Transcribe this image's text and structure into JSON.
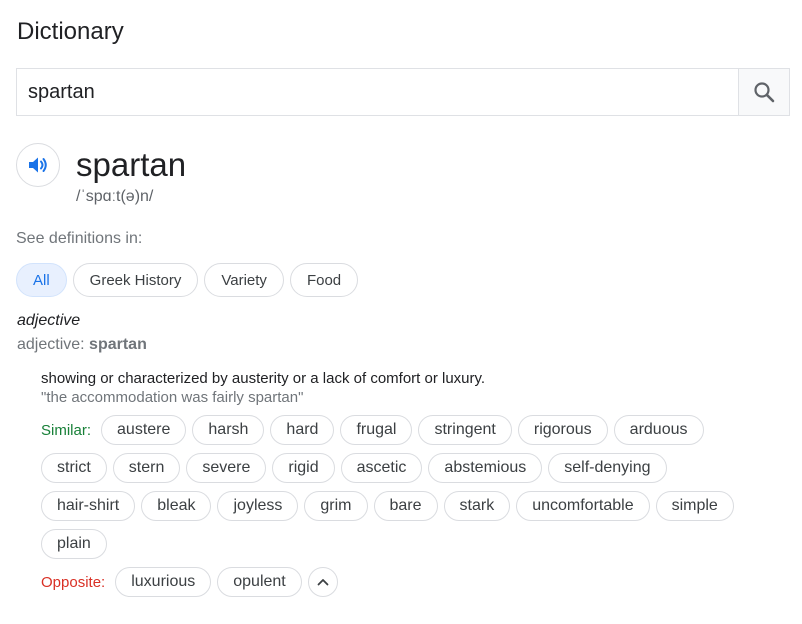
{
  "title": "Dictionary",
  "search": {
    "value": "spartan"
  },
  "entry": {
    "word": "spartan",
    "phonetic": "/ˈspɑːt(ə)n/"
  },
  "see_definitions_label": "See definitions in:",
  "categories": [
    "All",
    "Greek History",
    "Variety",
    "Food"
  ],
  "sense": {
    "part_of_speech": "adjective",
    "pos_prefix": "adjective: ",
    "pos_word": "spartan",
    "definition": "showing or characterized by austerity or a lack of comfort or luxury.",
    "example": "\"the accommodation was fairly spartan\"",
    "similar_label": "Similar:",
    "similar_rows": [
      [
        "austere",
        "harsh",
        "hard",
        "frugal",
        "stringent",
        "rigorous",
        "arduous"
      ],
      [
        "strict",
        "stern",
        "severe",
        "rigid",
        "ascetic",
        "abstemious",
        "self-denying"
      ],
      [
        "hair-shirt",
        "bleak",
        "joyless",
        "grim",
        "bare",
        "stark",
        "uncomfortable",
        "simple"
      ],
      [
        "plain"
      ]
    ],
    "opposite_label": "Opposite:",
    "opposites": [
      "luxurious",
      "opulent"
    ]
  },
  "colors": {
    "similar_label": "#188038",
    "opposite_label": "#d93025",
    "accent_blue": "#1a73e8"
  },
  "icons": [
    "search-icon",
    "speaker-icon",
    "chevron-up-icon"
  ]
}
